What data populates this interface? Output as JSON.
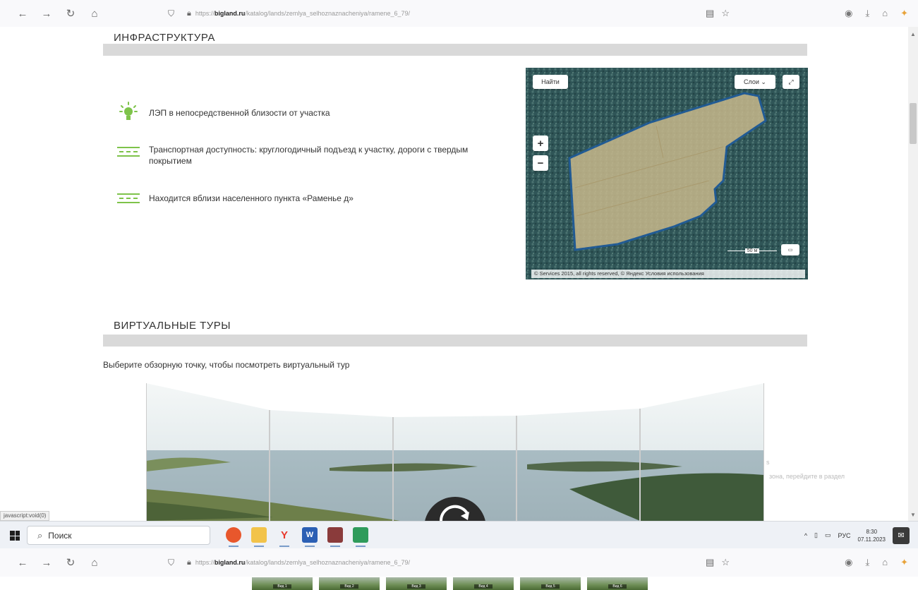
{
  "browser": {
    "url_prefix": "https://",
    "url_domain": "bigland.ru",
    "url_path": "/katalog/lands/zemlya_selhoznaznacheniya/ramene_6_79/"
  },
  "infra": {
    "title": "ИНФРАСТРУКТУРА",
    "items": [
      {
        "text": "ЛЭП в непосредственной близости от участка"
      },
      {
        "text": "Транспортная доступность: круглогодичный подъезд к участку, дороги с твердым покрытием"
      },
      {
        "text": "Находится вблизи населенного пункта «Раменье д»"
      }
    ]
  },
  "map": {
    "find_label": "Найти",
    "layers_label": "Слои",
    "zoom_in": "+",
    "zoom_out": "−",
    "scale_label": "50 м",
    "attribution": "© Services 2015, all rights reserved, © Яндекс Условия использования"
  },
  "tours": {
    "title": "ВИРТУАЛЬНЫЕ ТУРЫ",
    "hint": "Выберите обзорную точку, чтобы посмотреть виртуальный тур"
  },
  "faded": {
    "line1": "s",
    "line2": "зона, перейдите в раздел"
  },
  "status_url": "javascript:void(0)",
  "taskbar": {
    "search_placeholder": "Поиск",
    "lang": "РУС",
    "time": "8:30",
    "date": "07.11.2023"
  },
  "thumbs": [
    "Вид 1",
    "Вид 2",
    "Вид 3",
    "Вид 4",
    "Вид 5",
    "Вид 6"
  ],
  "colors": {
    "accent_green": "#7ec34a",
    "section_bar": "#d9d9d9"
  }
}
